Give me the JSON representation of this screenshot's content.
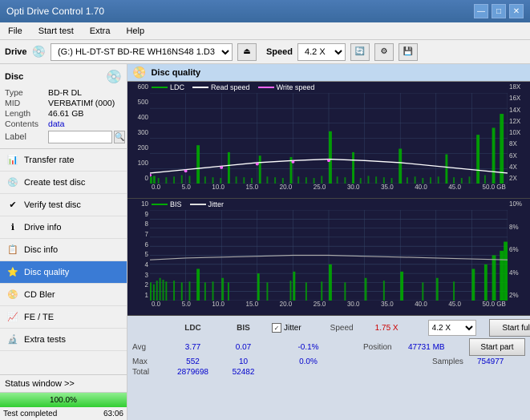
{
  "app": {
    "title": "Opti Drive Control 1.70",
    "min_label": "—",
    "max_label": "□",
    "close_label": "✕"
  },
  "menu": {
    "items": [
      "File",
      "Start test",
      "Extra",
      "Help"
    ]
  },
  "drive_bar": {
    "drive_label": "Drive",
    "drive_value": "(G:)  HL-DT-ST BD-RE  WH16NS48 1.D3",
    "speed_label": "Speed",
    "speed_value": "4.2 X"
  },
  "disc": {
    "title": "Disc",
    "type_label": "Type",
    "type_value": "BD-R DL",
    "mid_label": "MID",
    "mid_value": "VERBATIMf (000)",
    "length_label": "Length",
    "length_value": "46.61 GB",
    "contents_label": "Contents",
    "contents_value": "data",
    "label_label": "Label",
    "label_value": ""
  },
  "nav": {
    "items": [
      {
        "id": "transfer-rate",
        "label": "Transfer rate",
        "icon": "📊"
      },
      {
        "id": "create-test-disc",
        "label": "Create test disc",
        "icon": "💿"
      },
      {
        "id": "verify-test-disc",
        "label": "Verify test disc",
        "icon": "✔"
      },
      {
        "id": "drive-info",
        "label": "Drive info",
        "icon": "ℹ"
      },
      {
        "id": "disc-info",
        "label": "Disc info",
        "icon": "📋"
      },
      {
        "id": "disc-quality",
        "label": "Disc quality",
        "icon": "⭐",
        "active": true
      },
      {
        "id": "cd-bler",
        "label": "CD Bler",
        "icon": "📀"
      },
      {
        "id": "fe-te",
        "label": "FE / TE",
        "icon": "📈"
      },
      {
        "id": "extra-tests",
        "label": "Extra tests",
        "icon": "🔬"
      }
    ]
  },
  "status": {
    "window_label": "Status window >>",
    "progress_pct": 100,
    "progress_text": "100.0%",
    "status_text": "Test completed",
    "time_text": "63:06"
  },
  "chart": {
    "title": "Disc quality",
    "upper": {
      "legend": [
        {
          "label": "LDC",
          "color": "#00aa00"
        },
        {
          "label": "Read speed",
          "color": "#ffffff"
        },
        {
          "label": "Write speed",
          "color": "#ff66ff"
        }
      ],
      "y_axis_left": [
        "600",
        "500",
        "400",
        "300",
        "200",
        "100",
        "0"
      ],
      "y_axis_right": [
        "18X",
        "16X",
        "14X",
        "12X",
        "10X",
        "8X",
        "6X",
        "4X",
        "2X"
      ],
      "x_axis": [
        "0.0",
        "5.0",
        "10.0",
        "15.0",
        "20.0",
        "25.0",
        "30.0",
        "35.0",
        "40.0",
        "45.0",
        "50.0 GB"
      ]
    },
    "lower": {
      "legend": [
        {
          "label": "BIS",
          "color": "#00aa00"
        },
        {
          "label": "Jitter",
          "color": "#dddddd"
        }
      ],
      "y_axis_left": [
        "10",
        "9",
        "8",
        "7",
        "6",
        "5",
        "4",
        "3",
        "2",
        "1"
      ],
      "y_axis_right": [
        "10%",
        "8%",
        "6%",
        "4%",
        "2%"
      ],
      "x_axis": [
        "0.0",
        "5.0",
        "10.0",
        "15.0",
        "20.0",
        "25.0",
        "30.0",
        "35.0",
        "40.0",
        "45.0",
        "50.0 GB"
      ]
    }
  },
  "stats": {
    "headers": [
      "LDC",
      "BIS",
      "",
      "Jitter",
      "Speed",
      ""
    ],
    "avg_label": "Avg",
    "avg_ldc": "3.77",
    "avg_bis": "0.07",
    "avg_jitter": "-0.1%",
    "max_label": "Max",
    "max_ldc": "552",
    "max_bis": "10",
    "max_jitter": "0.0%",
    "total_label": "Total",
    "total_ldc": "2879698",
    "total_bis": "52482",
    "jitter_check": "✓",
    "speed_label": "Speed",
    "speed_value": "1.75 X",
    "position_label": "Position",
    "position_value": "47731 MB",
    "samples_label": "Samples",
    "samples_value": "754977",
    "speed_select": "4.2 X",
    "start_full_label": "Start full",
    "start_part_label": "Start part"
  }
}
